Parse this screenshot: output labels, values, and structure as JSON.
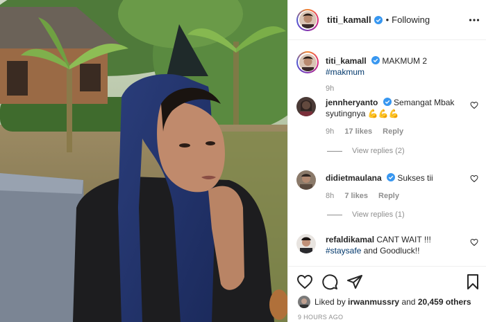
{
  "photo": {
    "description_icon": "photo-scene"
  },
  "header": {
    "username": "titi_kamall",
    "separator": "•",
    "follow_status": "Following",
    "verified_icon": "verified-badge-icon",
    "more_icon": "more-options-icon"
  },
  "caption": {
    "username": "titi_kamall",
    "text": "MAKMUM 2",
    "hashtag": "#makmum",
    "time": "9h"
  },
  "comments": [
    {
      "username": "jennheryanto",
      "verified": true,
      "text": "Semangat Mbak syutingnya",
      "emoji": "💪💪💪",
      "time": "9h",
      "likes": "17 likes",
      "reply": "Reply",
      "view_replies": "View replies (2)"
    },
    {
      "username": "didietmaulana",
      "verified": true,
      "text": "Sukses tii",
      "time": "8h",
      "likes": "7 likes",
      "reply": "Reply",
      "view_replies": "View replies (1)"
    },
    {
      "username": "refaldikamal",
      "verified": false,
      "text_part1": "CANT WAIT !!!",
      "hashtag": "#staysafe",
      "text_part2": "and Goodluck!!"
    }
  ],
  "actions": {
    "like_icon": "heart-icon",
    "comment_icon": "comment-icon",
    "share_icon": "share-icon",
    "save_icon": "bookmark-icon",
    "liked_by_prefix": "Liked by",
    "liked_by_user": "irwanmussry",
    "liked_by_and": "and",
    "liked_by_count": "20,459 others",
    "time_ago": "9 HOURS AGO"
  },
  "colors": {
    "text": "#262626",
    "muted": "#8e8e8e",
    "hashtag": "#00376b",
    "verified": "#3897f0",
    "divider": "#efefef"
  }
}
